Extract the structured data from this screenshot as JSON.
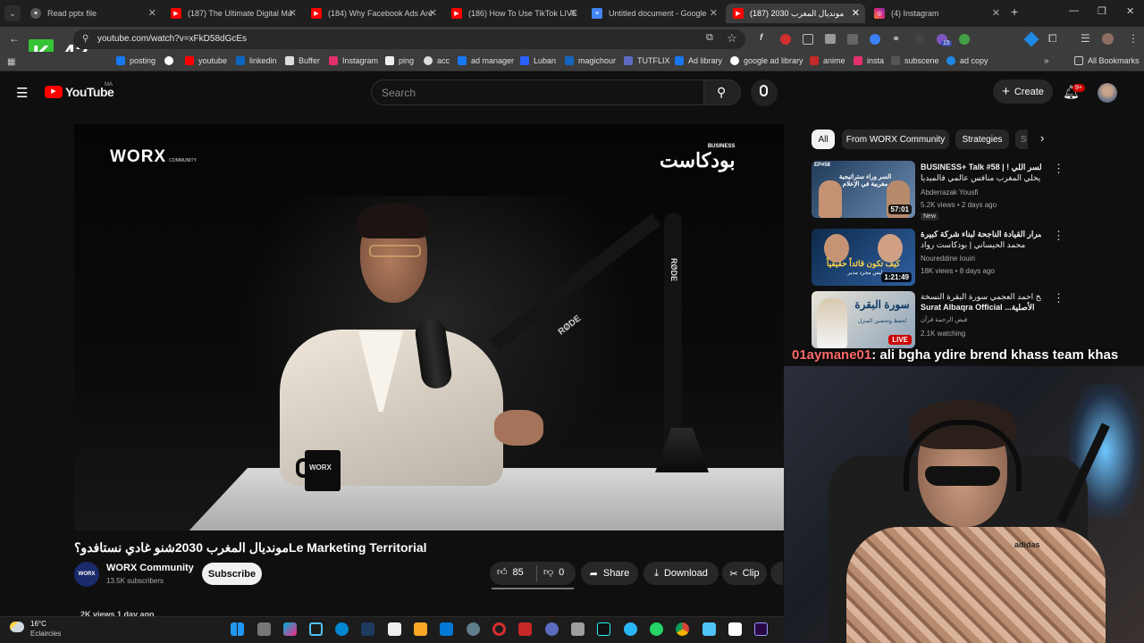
{
  "browser": {
    "tabs": [
      {
        "title": "Read pptx file",
        "icon": "chatgpt-icon",
        "color": "#bdbdbd"
      },
      {
        "title": "(187) The Ultimate Digital Ma",
        "icon": "youtube-icon",
        "color": "#ff0000"
      },
      {
        "title": "(184) Why Facebook Ads Are",
        "icon": "youtube-icon",
        "color": "#ff0000"
      },
      {
        "title": "(186) How To Use TikTok LIVE",
        "icon": "youtube-icon",
        "color": "#ff0000"
      },
      {
        "title": "Untitled document - Google",
        "icon": "docs-icon",
        "color": "#4285f4"
      },
      {
        "title": "(187) موندیال المغرب 2030",
        "icon": "youtube-icon",
        "color": "#ff0000"
      },
      {
        "title": "(4) Instagram",
        "icon": "instagram-icon",
        "color": "#e1306c"
      }
    ],
    "url": "youtube.com/watch?v=xFkD58dGcEs",
    "bookmarks": [
      "posting",
      "youtube",
      "linkedin",
      "Buffer",
      "Instagram",
      "ping",
      "acc",
      "ad manager",
      "Luban",
      "magichour",
      "TUTFLIX",
      "Ad library",
      "google ad library",
      "anime",
      "insta",
      "subscene",
      "ad copy"
    ],
    "all_bookmarks": "All Bookmarks",
    "overlay_counter": "42",
    "overlay_letter": "K",
    "ext_badge": "15"
  },
  "youtube": {
    "logo": "YouTube",
    "region": "MA",
    "search_placeholder": "Search",
    "create": "Create",
    "notif_count": "9+"
  },
  "video": {
    "brand_left": "WORX",
    "brand_left_sub": "COMMUNITY",
    "brand_right": "بودكاست",
    "brand_right_sup": "BUSINESS",
    "mic_brand": "RØDE",
    "mug_brand": "WORX",
    "title": "موندیال المغرب 2030شنو غادي نستافدو؟Le Marketing Territorial",
    "channel": "WORX Community",
    "channel_logo": "WORX",
    "subscribers": "13.5K subscribers",
    "subscribe": "Subscribe",
    "likes": "85",
    "dislikes": "0",
    "share": "Share",
    "download": "Download",
    "clip": "Clip",
    "meta_cut": "2K views  1 day ago"
  },
  "chips": [
    "All",
    "From WORX Community",
    "Strategies",
    "S"
  ],
  "recommendations": [
    {
      "title1": "BUSINESS+ Talk #58 | ! السر اللي",
      "title2": "يخلي المغرب منافس عالمي فالميديا",
      "channel": "Abderrazak Yousfi",
      "meta": "5.2K views • 2 days ago",
      "badge": "New",
      "duration": "57:01",
      "thumb_text": "السر وراء ستراتيجية مغربية في الإعلام",
      "thumb_tag": "EP#58"
    },
    {
      "title1": "أسرار القيادة الناجحة لبناء شركة كبيرة |",
      "title2": "محمد الحيساني | بودكاست رواد",
      "channel": "Noureddine Iouiri",
      "meta": "18K views • 8 days ago",
      "badge": "",
      "duration": "1:21:49",
      "thumb_text": "كيف تكون قائداً حقيقياً",
      "thumb_sub": "ليس مجرد مدير"
    },
    {
      "title1": "الشيخ احمد العجمي سورة البقرة النسخة",
      "title2": "Surat Albaqra Official ...الأصلية",
      "channel": "فيض الرحمة قرآن",
      "meta": "2.1K watching",
      "badge": "LIVE",
      "duration": "",
      "thumb_text": "سورة البقرة",
      "thumb_sub": "لحفظ وتحصين المنزل"
    }
  ],
  "stream": {
    "chat_user": "01aymane01",
    "chat_message": ": ali bgha ydire brend khass team khas",
    "shirt_brand": "adidas"
  },
  "taskbar": {
    "temperature": "16°C",
    "weather": "Eclaircies"
  }
}
